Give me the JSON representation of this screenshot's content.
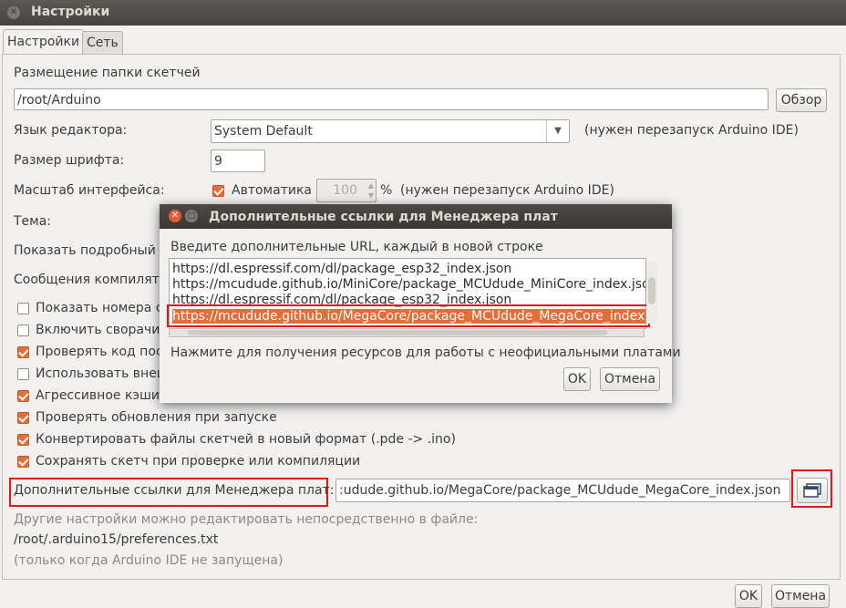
{
  "window": {
    "title": "Настройки"
  },
  "tabs": [
    {
      "label": "Настройки"
    },
    {
      "label": "Сеть"
    }
  ],
  "sketchbook": {
    "label": "Размещение папки скетчей",
    "value": "/root/Arduino",
    "browse": "Обзор"
  },
  "language": {
    "label": "Язык редактора:",
    "value": "System Default",
    "note": "(нужен перезапуск Arduino IDE)"
  },
  "font_size": {
    "label": "Размер шрифта:",
    "value": "9"
  },
  "scale": {
    "label": "Масштаб интерфейса:",
    "auto_label": "Автоматика",
    "value": "100",
    "unit": "%",
    "note": "(нужен перезапуск Arduino IDE)"
  },
  "theme": {
    "label": "Тема:"
  },
  "verbose": {
    "label": "Показать подробный в"
  },
  "compiler_warnings": {
    "label": "Сообщения компилято"
  },
  "checkboxes": [
    {
      "label": "Показать номера ст",
      "checked": false
    },
    {
      "label": "Включить сворачив",
      "checked": false
    },
    {
      "label": "Проверять код пос",
      "checked": true
    },
    {
      "label": "Использовать внеш",
      "checked": false
    },
    {
      "label": "Агрессивное кэшир",
      "checked": true
    },
    {
      "label": "Проверять обновления при запуске",
      "checked": true
    },
    {
      "label": "Конвертировать файлы скетчей в новый формат (.pde -> .ino)",
      "checked": true
    },
    {
      "label": "Сохранять скетч при проверке или компиляции",
      "checked": true
    }
  ],
  "board_urls": {
    "label": "Дополнительные ссылки для Менеджера плат:",
    "value": ":udude.github.io/MegaCore/package_MCUdude_MegaCore_index.json"
  },
  "footer": {
    "more_prefs": "Другие настройки можно редактировать непосредственно в файле:",
    "path": "/root/.arduino15/preferences.txt",
    "note": "(только когда Arduino IDE не запущена)"
  },
  "buttons": {
    "ok": "OK",
    "cancel": "Отмена"
  },
  "dialog": {
    "title": "Дополнительные ссылки для Менеджера плат",
    "instructions": "Введите дополнительные URL, каждый в новой строке",
    "urls": [
      "https://dl.espressif.com/dl/package_esp32_index.json",
      "https://mcudude.github.io/MiniCore/package_MCUdude_MiniCore_index.json",
      "https://dl.espressif.com/dl/package_esp32_index.json",
      "https://mcudude.github.io/MegaCore/package_MCUdude_MegaCore_index.json"
    ],
    "link": "Нажмите для получения ресурсов для работы с неофициальными платами",
    "ok": "OK",
    "cancel": "Отмена"
  },
  "colors": {
    "accent": "#e46d38",
    "highlight_box": "#e01818",
    "titlebar": "#45443f"
  }
}
